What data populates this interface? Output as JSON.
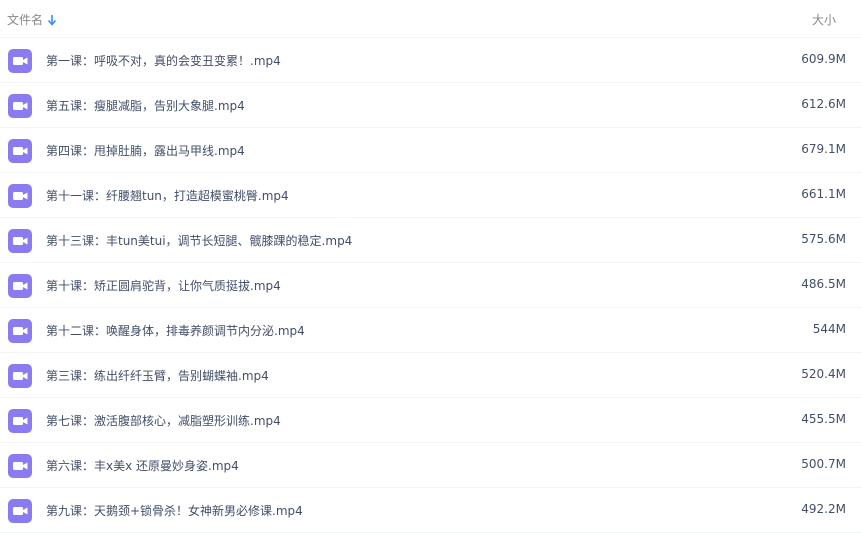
{
  "header": {
    "name_label": "文件名",
    "size_label": "大小",
    "sort_icon": "arrow-down-icon"
  },
  "colors": {
    "icon_purple": "#8a7cf0",
    "text": "#424e67",
    "header_text": "#888888",
    "accent": "#3b8cff"
  },
  "files": [
    {
      "name": "第一课：呼吸不对，真的会变丑变累！.mp4",
      "size": "609.9M",
      "icon": "video-file-icon"
    },
    {
      "name": "第五课：瘦腿减脂，告别大象腿.mp4",
      "size": "612.6M",
      "icon": "video-file-icon"
    },
    {
      "name": "第四课：甩掉肚腩，露出马甲线.mp4",
      "size": "679.1M",
      "icon": "video-file-icon"
    },
    {
      "name": "第十一课：纤腰翘tun，打造超模蜜桃臀.mp4",
      "size": "661.1M",
      "icon": "video-file-icon"
    },
    {
      "name": "第十三课：丰tun美tui，调节长短腿、髋膝踝的稳定.mp4",
      "size": "575.6M",
      "icon": "video-file-icon"
    },
    {
      "name": "第十课：矫正圆肩驼背，让你气质挺拔.mp4",
      "size": "486.5M",
      "icon": "video-file-icon"
    },
    {
      "name": "第十二课：唤醒身体，排毒养颜调节内分泌.mp4",
      "size": "544M",
      "icon": "video-file-icon"
    },
    {
      "name": "第三课：练出纤纤玉臂，告别蝴蝶袖.mp4",
      "size": "520.4M",
      "icon": "video-file-icon"
    },
    {
      "name": "第七课：激活腹部核心，减脂塑形训练.mp4",
      "size": "455.5M",
      "icon": "video-file-icon"
    },
    {
      "name": "第六课：丰x美x 还原曼妙身姿.mp4",
      "size": "500.7M",
      "icon": "video-file-icon"
    },
    {
      "name": "第九课：天鹅颈+锁骨杀！女神新男必修课.mp4",
      "size": "492.2M",
      "icon": "video-file-icon"
    }
  ]
}
